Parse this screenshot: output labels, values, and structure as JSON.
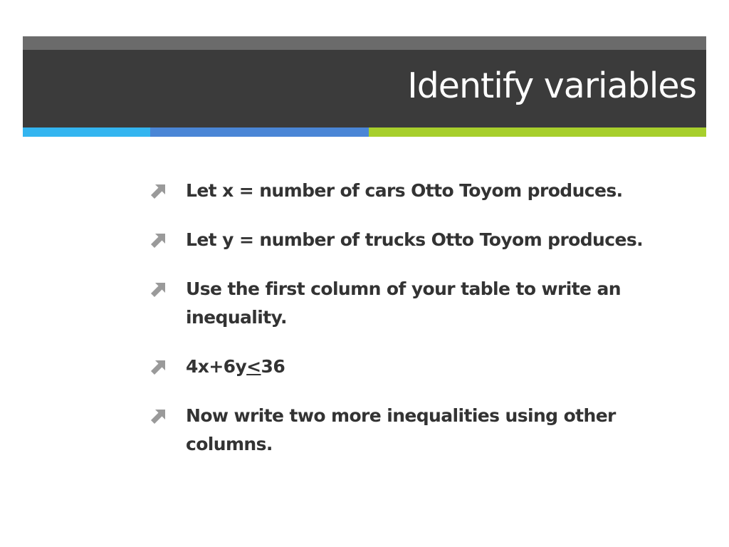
{
  "slide": {
    "title": "Identify variables",
    "colors": {
      "title_bar": "#3b3b3b",
      "title_bar_top": "#6b6b6b",
      "accent_cyan": "#33b5f0",
      "accent_blue": "#4a86d6",
      "accent_green": "#a7cf2c",
      "bullet_icon": "#9a9a9a",
      "text": "#333333"
    },
    "bullet_icon": "arrow-up-right-icon",
    "bullets": [
      {
        "text": "Let x = number of cars Otto Toyom produces."
      },
      {
        "text": "Let y = number of trucks Otto Toyom produces."
      },
      {
        "text": "Use the first column of your table to write an inequality."
      },
      {
        "pre": "4x+6y",
        "sym": "<",
        "post": "36"
      },
      {
        "text": "Now write two more inequalities using other columns."
      }
    ]
  }
}
